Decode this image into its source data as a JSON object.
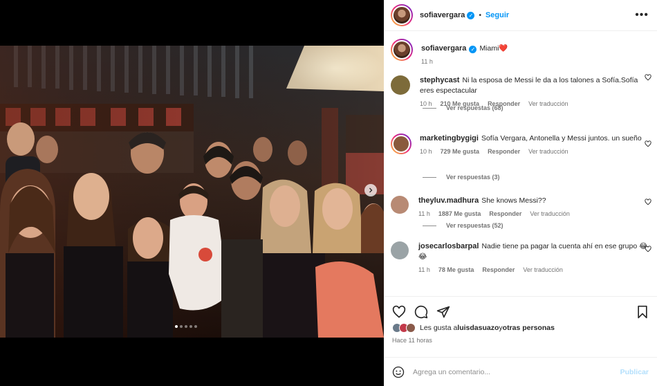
{
  "post": {
    "author": "sofiavergara",
    "follow_label": "Seguir",
    "caption_text": "Miami❤️",
    "caption_time": "11 h",
    "carousel_dots": 5,
    "carousel_active": 1
  },
  "comments": [
    {
      "user": "stephycast",
      "text": "Ni la esposa de Messi le da a los talones a Sofía.Sofía eres espectacular",
      "time": "10 h",
      "likes": "210 Me gusta",
      "reply": "Responder",
      "translate": "Ver traducción",
      "replies": "Ver respuestas (68)",
      "avatar_color": "#7d6b3a"
    },
    {
      "user": "marketingbygigi",
      "text": "Sofía Vergara, Antonella y Messi juntos. un sueño",
      "time": "10 h",
      "likes": "729 Me gusta",
      "reply": "Responder",
      "translate": "Ver traducción",
      "replies": "Ver respuestas (3)",
      "avatar_color": "#8a5a3c"
    },
    {
      "user": "theyluv.madhura",
      "text": "She knows Messi??",
      "time": "11 h",
      "likes": "1887 Me gusta",
      "reply": "Responder",
      "translate": "Ver traducción",
      "replies": "Ver respuestas (52)",
      "avatar_color": "#b88a74"
    },
    {
      "user": "josecarlosbarpal",
      "text": "Nadie tiene pa pagar la cuenta ahí en ese grupo 😂😂",
      "time": "11 h",
      "likes": "78 Me gusta",
      "reply": "Responder",
      "translate": "Ver traducción",
      "replies": "",
      "avatar_color": "#9aa3a6"
    }
  ],
  "likes_line": {
    "prefix": "Les gusta a ",
    "user": "luisdasuazo",
    "middle": " y ",
    "others": "otras personas"
  },
  "posted_ago": "Hace 11 horas",
  "add_comment": {
    "placeholder": "Agrega un comentario...",
    "publish_label": "Publicar"
  },
  "icons": [
    "heart-icon",
    "comment-icon",
    "share-icon",
    "bookmark-icon",
    "emoji-icon",
    "more-icon",
    "verified-icon",
    "chevron-right-icon"
  ],
  "colors": {
    "accent": "#0095f6",
    "muted": "#737373",
    "publish_disabled": "#b2dffc"
  }
}
